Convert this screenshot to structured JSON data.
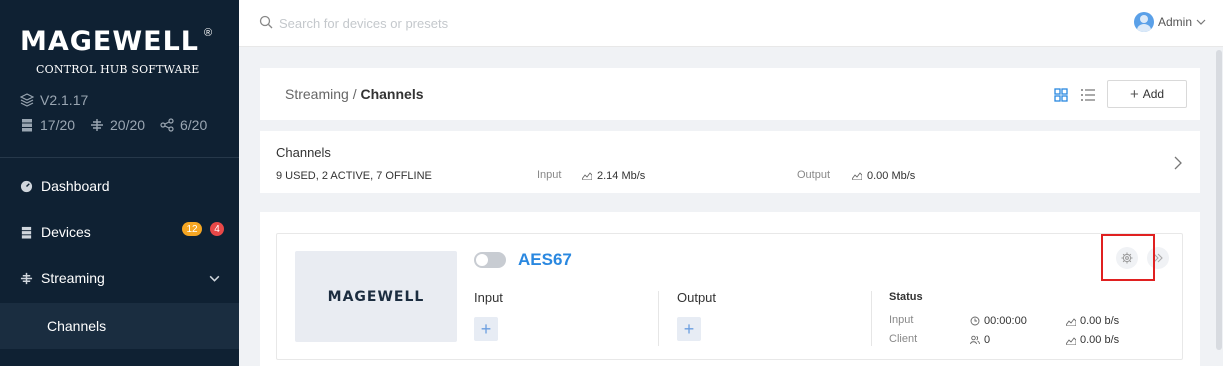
{
  "sidebar": {
    "brand": "MAGEWELL",
    "brand_mark": "®",
    "subtitle": "CONTROL HUB SOFTWARE",
    "version": "V2.1.17",
    "stats": [
      {
        "icon": "server-icon",
        "value": "17/20"
      },
      {
        "icon": "network-icon",
        "value": "20/20"
      },
      {
        "icon": "share-icon",
        "value": "6/20"
      }
    ],
    "nav": [
      {
        "label": "Dashboard",
        "icon": "dashboard-icon"
      },
      {
        "label": "Devices",
        "icon": "devices-icon",
        "badges": [
          "12",
          "4"
        ]
      },
      {
        "label": "Streaming",
        "icon": "streaming-icon",
        "expanded": true
      }
    ],
    "sub_item": "Channels"
  },
  "topbar": {
    "search_placeholder": "Search for devices or presets",
    "user": "Admin"
  },
  "header": {
    "crumb_parent": "Streaming",
    "crumb_sep": " / ",
    "crumb_current": "Channels",
    "add_label": "Add"
  },
  "summary": {
    "title": "Channels",
    "stats": "9 USED,  2 ACTIVE,  7 OFFLINE",
    "input_label": "Input",
    "input_value": "2.14 Mb/s",
    "output_label": "Output",
    "output_value": "0.00 Mb/s"
  },
  "channel": {
    "name": "AES67",
    "enabled": false,
    "thumb_logo": "MAGEWELL",
    "input_label": "Input",
    "output_label": "Output",
    "status_title": "Status",
    "status_input_label": "Input",
    "status_client_label": "Client",
    "duration": "00:00:00",
    "clients": "0",
    "input_rate": "0.00 b/s",
    "client_rate": "0.00 b/s"
  },
  "colors": {
    "sidebar_bg": "#0f2133",
    "accent": "#2a88e0",
    "badge_orange": "#f5a623",
    "badge_red": "#e84848",
    "highlight": "#e02020"
  }
}
